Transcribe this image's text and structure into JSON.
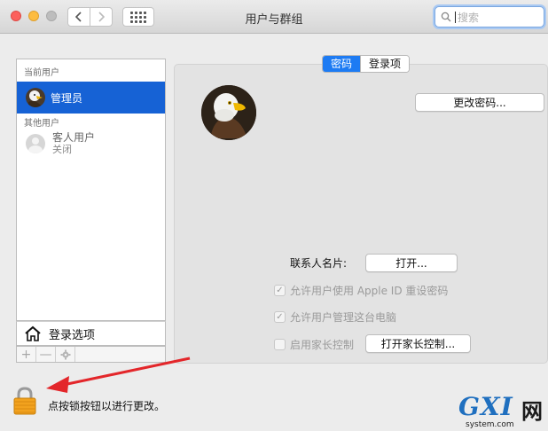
{
  "window": {
    "title": "用户与群组"
  },
  "search": {
    "placeholder": "搜索"
  },
  "sidebar": {
    "current_header": "当前用户",
    "current_user": "管理员",
    "other_header": "其他用户",
    "guest_name": "客人用户",
    "guest_status": "关闭",
    "login_options": "登录选项"
  },
  "toolbar": {
    "add": "+",
    "remove": "—"
  },
  "tabs": [
    {
      "label": "密码"
    },
    {
      "label": "登录项"
    }
  ],
  "main": {
    "change_password": "更改密码...",
    "contact_card_label": "联系人名片:",
    "open_button": "打开...",
    "checkbox1": "允许用户使用 Apple ID 重设密码",
    "checkbox2": "允许用户管理这台电脑",
    "checkbox3": "启用家长控制",
    "parental_button": "打开家长控制..."
  },
  "lock": {
    "text": "点按锁按钮以进行更改。"
  },
  "watermark": {
    "main": "GXI",
    "cn": "网",
    "sub": "system.com"
  },
  "colors": {
    "accent": "#1d7bf3",
    "selection": "#1662d5",
    "arrow": "#e3262a"
  }
}
